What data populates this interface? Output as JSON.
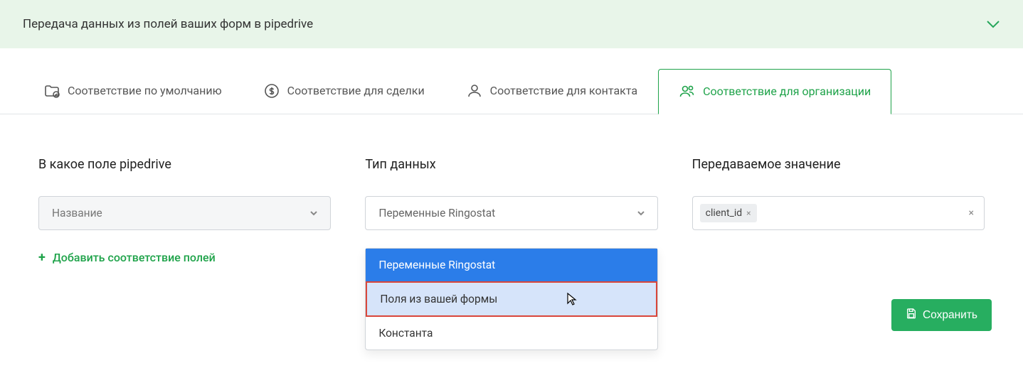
{
  "header": {
    "title": "Передача данных из полей ваших форм в pipedrive"
  },
  "tabs": [
    {
      "label": "Соответствие по умолчанию"
    },
    {
      "label": "Соответствие для сделки"
    },
    {
      "label": "Соответствие для контакта"
    },
    {
      "label": "Соответствие для организации"
    }
  ],
  "columns": {
    "field": {
      "label": "В какое поле pipedrive",
      "selected": "Название"
    },
    "type": {
      "label": "Тип данных",
      "selected": "Переменные Ringostat",
      "options": [
        "Переменные Ringostat",
        "Поля из вашей формы",
        "Константа"
      ]
    },
    "value": {
      "label": "Передаваемое значение",
      "tag": "client_id"
    }
  },
  "actions": {
    "add_mapping": "Добавить соответствие полей",
    "save": "Сохранить"
  }
}
